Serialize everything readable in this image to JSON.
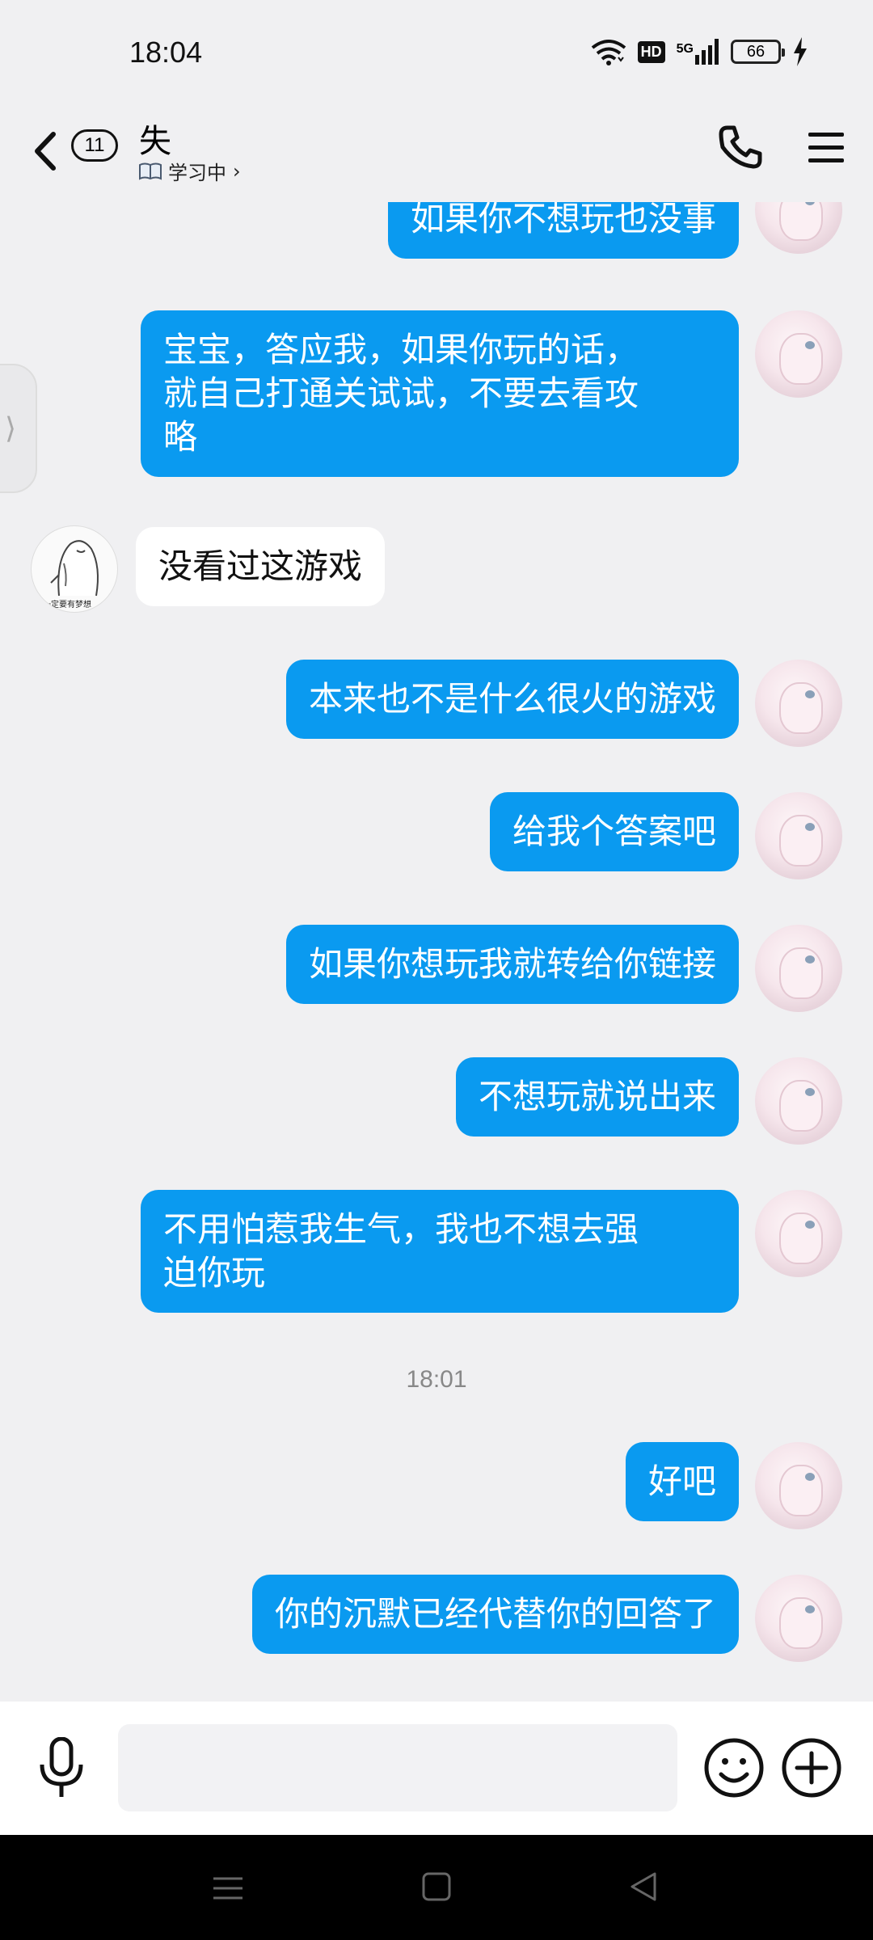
{
  "status_bar": {
    "time": "18:04",
    "hd_label": "HD",
    "network_label": "5G",
    "battery_level": "66"
  },
  "header": {
    "unread_count": "11",
    "contact_name": "失",
    "status_icon": "book-icon",
    "status_text": "学习中",
    "status_chevron": "›"
  },
  "messages": [
    {
      "direction": "out",
      "text": "如果你不想玩也没事"
    },
    {
      "direction": "out",
      "lines": [
        "宝宝，答应我，如果你玩的话，",
        "就自己打通关试试，不要去看攻",
        "略"
      ]
    },
    {
      "direction": "in",
      "text": "没看过这游戏",
      "avatar_caption": "一定要有梦想"
    },
    {
      "direction": "out",
      "text": "本来也不是什么很火的游戏"
    },
    {
      "direction": "out",
      "text": "给我个答案吧"
    },
    {
      "direction": "out",
      "text": "如果你想玩我就转给你链接"
    },
    {
      "direction": "out",
      "text": "不想玩就说出来"
    },
    {
      "direction": "out",
      "lines": [
        "不用怕惹我生气，我也不想去强",
        "迫你玩"
      ]
    },
    {
      "direction": "out",
      "text": "好吧"
    },
    {
      "direction": "out",
      "text": "你的沉默已经代替你的回答了"
    }
  ],
  "time_separator": "18:01",
  "side_tab_glyph": "⟩",
  "input_bar": {
    "placeholder": ""
  },
  "colors": {
    "outgoing_bubble": "#0a9af0",
    "incoming_bubble": "#ffffff",
    "background": "#f0f0f2"
  }
}
